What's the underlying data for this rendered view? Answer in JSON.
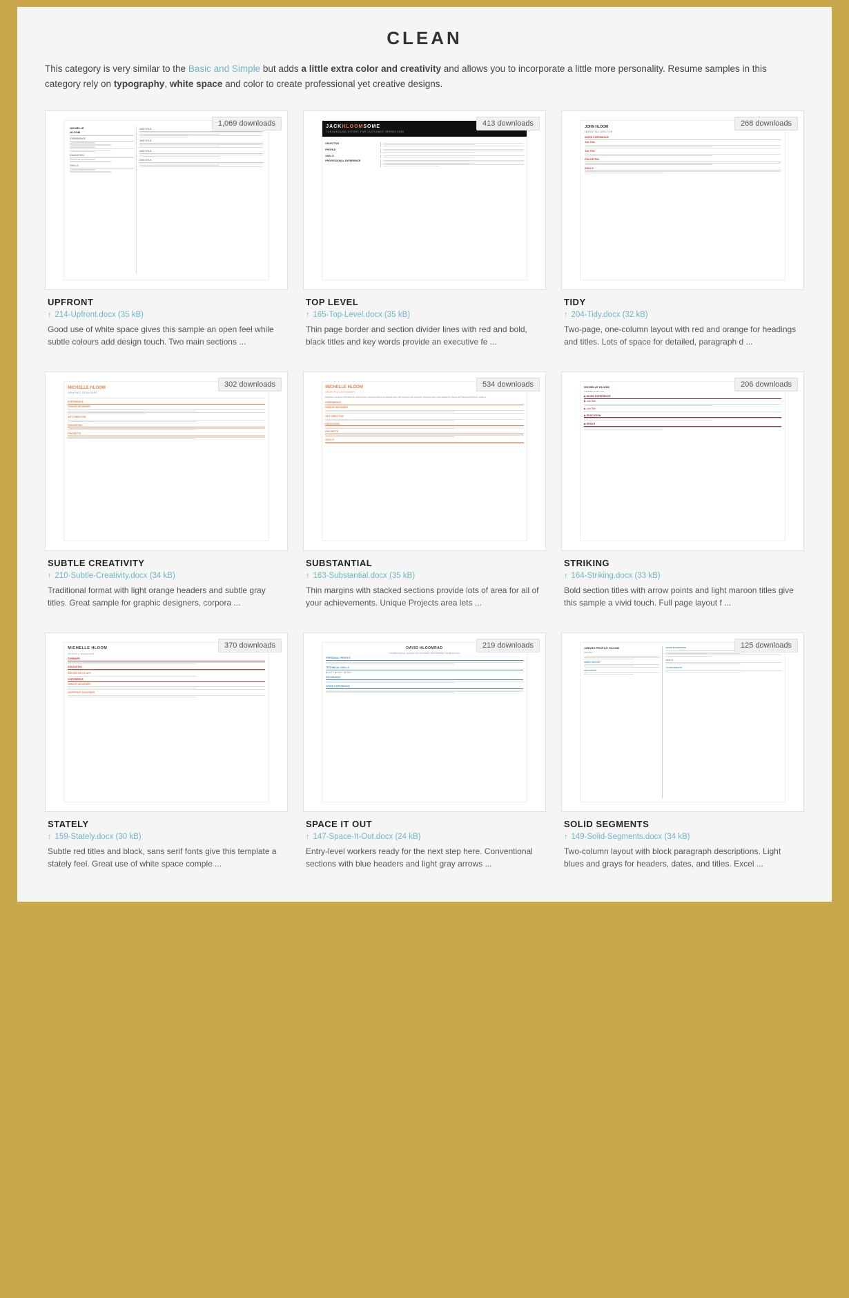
{
  "page": {
    "title": "CLEAN",
    "intro": "This category is very similar to the ",
    "intro_link_text": "Basic and Simple",
    "intro_after_link": " but adds ",
    "intro_bold1": "a little extra color and creativity",
    "intro_after_bold1": " and allows you to incorporate a little more personality. Resume samples in this category rely on ",
    "intro_bold2": "typography",
    "intro_comma": ", ",
    "intro_bold3": "white space",
    "intro_after_bold3": " and color to create professional yet creative designs."
  },
  "resumes": [
    {
      "id": "upfront",
      "title": "UPFRONT",
      "downloads": "1,069 downloads",
      "file": "214-Upfront.docx (35 kB)",
      "desc": "Good use of white space gives this sample an open feel while subtle colours add design touch. Two main sections ...",
      "preview_type": "upfront"
    },
    {
      "id": "top-level",
      "title": "TOP LEVEL",
      "downloads": "413 downloads",
      "file": "165-Top-Level.docx (35 kB)",
      "desc": "Thin page border and section divider lines with red and bold, black titles and key words provide an executive fe ...",
      "preview_type": "toplevel"
    },
    {
      "id": "tidy",
      "title": "TIDY",
      "downloads": "268 downloads",
      "file": "204-Tidy.docx (32 kB)",
      "desc": "Two-page, one-column layout with red and orange for headings and titles. Lots of space for detailed, paragraph d ...",
      "preview_type": "tidy"
    },
    {
      "id": "subtle-creativity",
      "title": "SUBTLE CREATIVITY",
      "downloads": "302 downloads",
      "file": "210-Subtle-Creativity.docx (34 kB)",
      "desc": "Traditional format with light orange headers and subtle gray titles. Great sample for graphic designers, corpora ...",
      "preview_type": "subtle"
    },
    {
      "id": "substantial",
      "title": "SUBSTANTIAL",
      "downloads": "534 downloads",
      "file": "163-Substantial.docx (35 kB)",
      "desc": "Thin margins with stacked sections provide lots of area for all of your achievements. Unique Projects area lets ...",
      "preview_type": "substantial"
    },
    {
      "id": "striking",
      "title": "STRIKING",
      "downloads": "206 downloads",
      "file": "164-Striking.docx (33 kB)",
      "desc": "Bold section titles with arrow points and light maroon titles give this sample a vivid touch. Full page layout f ...",
      "preview_type": "striking"
    },
    {
      "id": "stately",
      "title": "STATELY",
      "downloads": "370 downloads",
      "file": "159-Stately.docx (30 kB)",
      "desc": "Subtle red titles and block, sans serif fonts give this template a stately feel. Great use of white space comple ...",
      "preview_type": "stately"
    },
    {
      "id": "space-it-out",
      "title": "SPACE IT OUT",
      "downloads": "219 downloads",
      "file": "147-Space-It-Out.docx (24 kB)",
      "desc": "Entry-level workers ready for the next step here. Conventional sections with blue headers and light gray arrows ...",
      "preview_type": "spaceitout"
    },
    {
      "id": "solid-segments",
      "title": "SOLID SEGMENTS",
      "downloads": "125 downloads",
      "file": "149-Solid-Segments.docx (34 kB)",
      "desc": "Two-column layout with block paragraph descriptions. Light blues and grays for headers, dates, and titles. Excel ...",
      "preview_type": "solid"
    }
  ]
}
